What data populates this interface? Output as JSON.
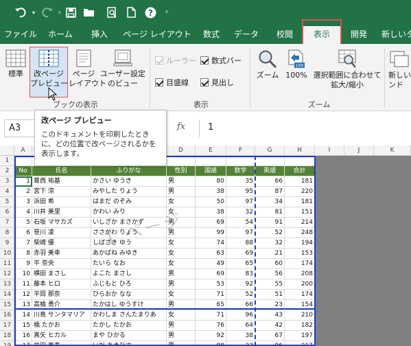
{
  "ribbon_tabs": [
    {
      "label": "ファイル"
    },
    {
      "label": "ホーム"
    },
    {
      "label": "挿入"
    },
    {
      "label": "ページ レイアウト"
    },
    {
      "label": "数式"
    },
    {
      "label": "データ"
    },
    {
      "label": "校閲"
    },
    {
      "label": "表示"
    },
    {
      "label": "開発"
    },
    {
      "label": "新しいタブ"
    }
  ],
  "active_tab": "表示",
  "ribbon": {
    "workbook_views": {
      "group_label": "ブックの表示",
      "normal": "標準",
      "page_break_l1": "改ページ",
      "page_break_l2": "プレビュー",
      "page_layout_l1": "ページ",
      "page_layout_l2": "レイアウト",
      "custom_l1": "ユーザー設定",
      "custom_l2": "のビュー"
    },
    "show": {
      "group_label": "表示",
      "ruler": "ルーラー",
      "formula_bar": "数式バー",
      "gridlines": "目盛線",
      "headings": "見出し"
    },
    "zoom": {
      "group_label": "ズーム",
      "zoom": "ズーム",
      "hundred": "100%",
      "selection_l1": "選択範囲に合わせて",
      "selection_l2": "拡大/縮小",
      "new_window_l1": "新しいウ",
      "new_window_l2": "ンド"
    }
  },
  "name_box": "A3",
  "formula_value": "1",
  "tooltip": {
    "title": "改ページ プレビュー",
    "body": "このドキュメントを印刷したときに、どの位置で改ページされるかを表示します。"
  },
  "columns": [
    "A",
    "B",
    "C",
    "D",
    "E",
    "F",
    "G",
    "H",
    "I",
    "J",
    "K"
  ],
  "rows": [
    "1",
    "2",
    "3",
    "4",
    "5",
    "6",
    "7",
    "8",
    "9",
    "10",
    "11",
    "12",
    "13",
    "14",
    "15",
    "16",
    "17",
    "18",
    "19"
  ],
  "table_headers": [
    "No",
    "氏名",
    "ふりがな",
    "性別",
    "国語",
    "数学",
    "英語",
    "合計"
  ],
  "table_rows": [
    [
      "1",
      "葛西 祐基",
      "かさい ゆうき",
      "男",
      "80",
      "35",
      "66",
      "181"
    ],
    [
      "2",
      "宮下 涼",
      "みやした りょう",
      "男",
      "38",
      "95",
      "87",
      "220"
    ],
    [
      "3",
      "浜田 希",
      "はまだ のぞみ",
      "女",
      "50",
      "97",
      "34",
      "181"
    ],
    [
      "4",
      "川井 美里",
      "かわい みり",
      "女",
      "38",
      "32",
      "81",
      "151"
    ],
    [
      "5",
      "石坂 マサカズ",
      "いしざか まさかず",
      "男",
      "69",
      "54",
      "91",
      "214"
    ],
    [
      "6",
      "笹川 凌",
      "ささがわ りょう",
      "男",
      "99",
      "97",
      "52",
      "248"
    ],
    [
      "7",
      "柴崎 優",
      "しばざき ゆう",
      "女",
      "74",
      "88",
      "32",
      "194"
    ],
    [
      "8",
      "赤羽 美幸",
      "あかばね みゆき",
      "女",
      "63",
      "69",
      "21",
      "153"
    ],
    [
      "9",
      "平 奈央",
      "たいら なお",
      "女",
      "49",
      "65",
      "60",
      "174"
    ],
    [
      "10",
      "横田 まさし",
      "よこた まさし",
      "男",
      "69",
      "83",
      "56",
      "208"
    ],
    [
      "11",
      "藤本 ヒロ",
      "ふじもと ひろ",
      "男",
      "53",
      "92",
      "55",
      "200"
    ],
    [
      "12",
      "平岡 那奈",
      "ひらおか なな",
      "女",
      "71",
      "52",
      "51",
      "174"
    ],
    [
      "13",
      "高橋 勇介",
      "たかはし ゆうすけ",
      "男",
      "65",
      "66",
      "23",
      "154"
    ],
    [
      "14",
      "川島 サンタマリア",
      "かわしま さんたまりあ",
      "女",
      "71",
      "96",
      "43",
      "210"
    ],
    [
      "15",
      "橋 たかお",
      "たかし たかお",
      "男",
      "76",
      "64",
      "42",
      "182"
    ],
    [
      "16",
      "真矢 ヒカル",
      "まや ひかる",
      "男",
      "92",
      "38",
      "67",
      "197"
    ],
    [
      "17",
      "井田 亮寿",
      "いだ あきひさ",
      "男",
      "88",
      "33",
      "96",
      "217"
    ]
  ],
  "watermark": "1 ページ",
  "colors": {
    "excel_green": "#217346",
    "header_green": "#548235",
    "page_break_blue": "#1f3fbf",
    "highlight_red": "#d9534f"
  }
}
